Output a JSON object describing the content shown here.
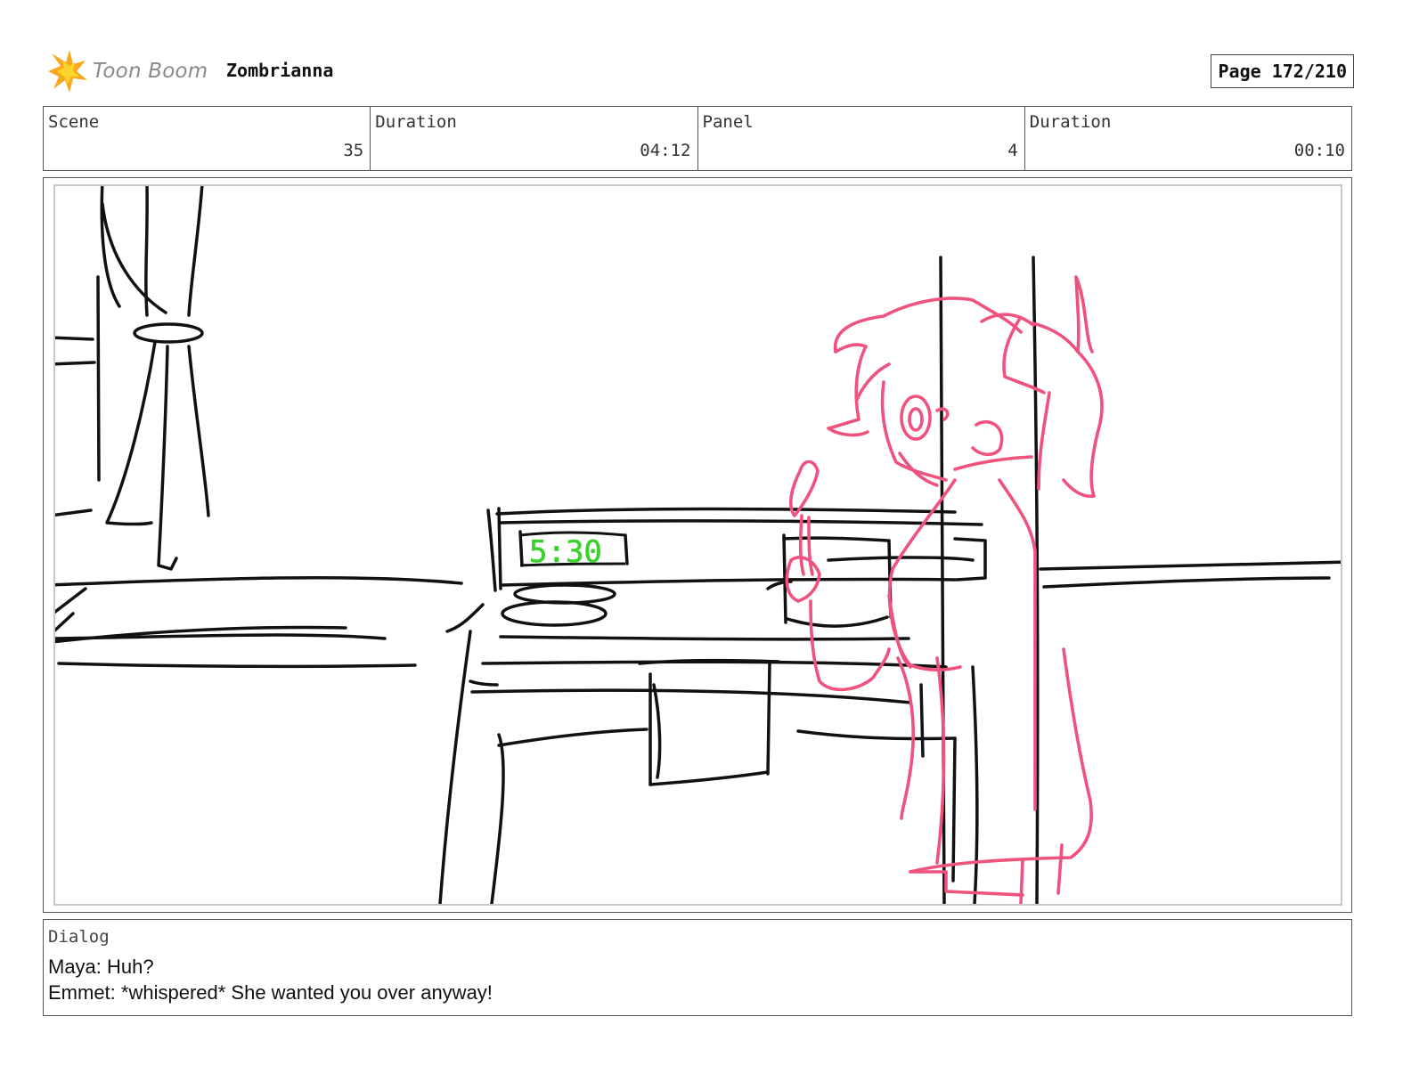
{
  "header": {
    "logo_text": "Toon Boom",
    "project_title": "Zombrianna",
    "page_label": "Page",
    "page_number": "172/210"
  },
  "info": {
    "scene_label": "Scene",
    "scene_value": "35",
    "scene_duration_label": "Duration",
    "scene_duration_value": "04:12",
    "panel_label": "Panel",
    "panel_value": "4",
    "panel_duration_label": "Duration",
    "panel_duration_value": "00:10"
  },
  "panel": {
    "clock_text": "5:30",
    "line_color": "#111111",
    "character_color": "#f0527e",
    "clock_color": "#3ad12a"
  },
  "dialog": {
    "label": "Dialog",
    "lines": [
      "Maya: Huh?",
      "Emmet: *whispered* She wanted you over anyway!"
    ]
  },
  "colors": {
    "logo_orange": "#f7a81b",
    "logo_yellow": "#ffd42a",
    "border": "#555555"
  }
}
